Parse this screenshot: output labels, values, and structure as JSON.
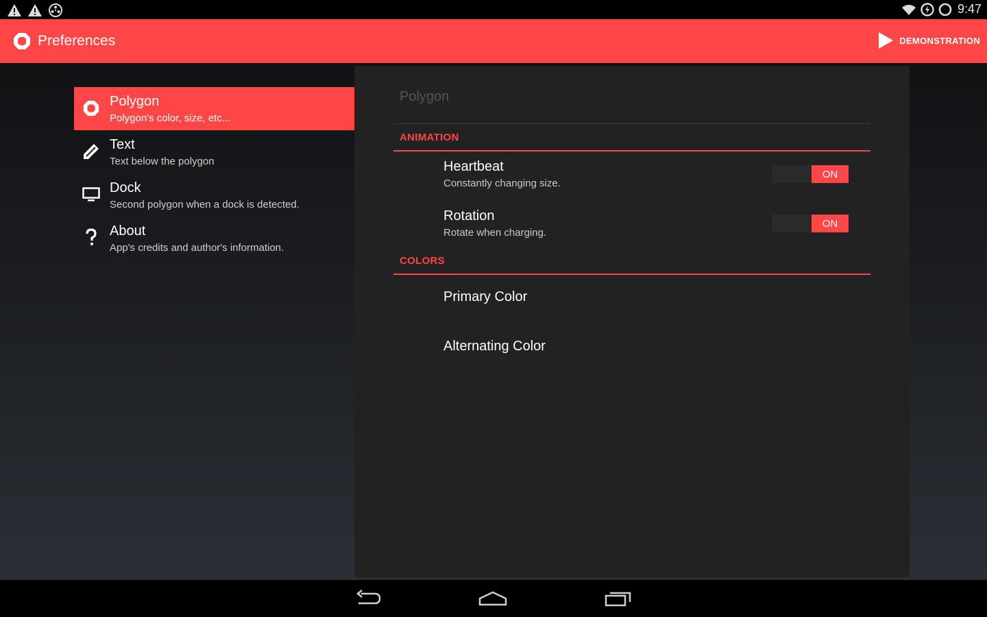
{
  "status_bar": {
    "left_icons": [
      "warning-icon",
      "warning-icon",
      "settings-notification-icon"
    ],
    "right_icons": [
      "wifi-icon",
      "battery-charging-icon",
      "sync-icon"
    ],
    "time": "9:47"
  },
  "action_bar": {
    "title": "Preferences",
    "action_label": "DEMONSTRATION",
    "accent_color": "#ff4646"
  },
  "headers": [
    {
      "title": "Polygon",
      "summary": "Polygon's color, size, etc...",
      "icon": "polygon-icon",
      "selected": true
    },
    {
      "title": "Text",
      "summary": "Text below the polygon",
      "icon": "pencil-icon",
      "selected": false
    },
    {
      "title": "Dock",
      "summary": "Second polygon when a dock is detected.",
      "icon": "monitor-icon",
      "selected": false
    },
    {
      "title": "About",
      "summary": "App's credits and author's information.",
      "icon": "question-icon",
      "selected": false
    }
  ],
  "panel": {
    "title": "Polygon",
    "categories": [
      {
        "label": "ANIMATION"
      },
      {
        "label": "COLORS"
      }
    ],
    "prefs": {
      "heartbeat": {
        "title": "Heartbeat",
        "summary": "Constantly changing size.",
        "toggle": "ON"
      },
      "rotation": {
        "title": "Rotation",
        "summary": "Rotate when charging.",
        "toggle": "ON"
      },
      "primary_color": {
        "title": "Primary Color"
      },
      "alternating_color": {
        "title": "Alternating Color"
      }
    }
  },
  "nav_bar": {
    "buttons": [
      "back-icon",
      "home-icon",
      "recents-icon"
    ]
  }
}
